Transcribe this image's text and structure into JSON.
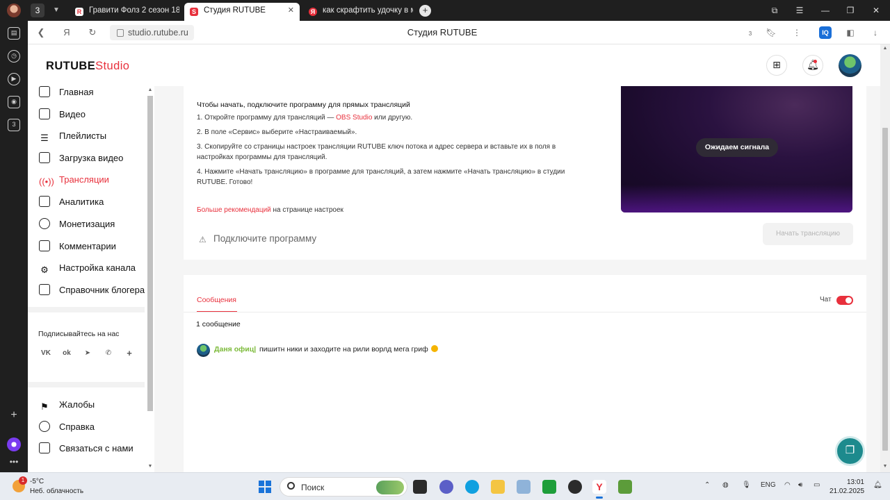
{
  "browser": {
    "window_counter": "3",
    "tabs": [
      {
        "title": "Гравити Фолз 2 сезон 18",
        "active": false
      },
      {
        "title": "Студия RUTUBE",
        "active": true
      },
      {
        "title": "как скрафтить удочку в м",
        "active": false
      }
    ],
    "new_tab": "+",
    "url": "studio.rutube.ru",
    "page_title": "Студия RUTUBE",
    "bookmarks_count": "3"
  },
  "side_panel": {
    "badge": "3"
  },
  "app": {
    "logo_main": "RUTUBE",
    "logo_studio": "Studio"
  },
  "nav": {
    "items": [
      {
        "label": "Главная",
        "icon": "home-icon"
      },
      {
        "label": "Видео",
        "icon": "video-icon"
      },
      {
        "label": "Плейлисты",
        "icon": "playlist-icon"
      },
      {
        "label": "Загрузка видео",
        "icon": "upload-icon"
      },
      {
        "label": "Трансляции",
        "icon": "broadcast-icon",
        "active": true
      },
      {
        "label": "Аналитика",
        "icon": "analytics-icon"
      },
      {
        "label": "Монетизация",
        "icon": "ruble-icon"
      },
      {
        "label": "Комментарии",
        "icon": "comments-icon"
      },
      {
        "label": "Настройка канала",
        "icon": "gear-icon"
      },
      {
        "label": "Справочник блогера",
        "icon": "info-icon"
      }
    ],
    "social_title": "Подписывайтесь на нас",
    "bottom_items": [
      {
        "label": "Жалобы",
        "icon": "flag-icon"
      },
      {
        "label": "Справка",
        "icon": "help-icon"
      },
      {
        "label": "Связаться с нами",
        "icon": "mail-icon"
      }
    ]
  },
  "stream": {
    "instructions_title": "Чтобы начать, подключите программу для прямых трансляций",
    "step1_pre": "1. Откройте программу для трансляций — ",
    "step1_link": "OBS Studio",
    "step1_post": " или другую.",
    "step2": "2. В поле «Сервис» выберите «Настраиваемый».",
    "step3": "3. Скопируйте со страницы настроек трансляции RUTUBE ключ потока и адрес сервера и вставьте их в поля в настройках программы для трансляций.",
    "step4": "4. Нажмите «Начать трансляцию» в программе для трансляций, а затем нажмите «Начать трансляцию» в студии RUTUBE. Готово!",
    "more_link": "Больше рекомендаций",
    "more_text": " на странице настроек",
    "connect_status": "Подключите программу",
    "waiting_signal": "Ожидаем сигнала",
    "start_button": "Начать трансляцию"
  },
  "chat": {
    "tab_messages": "Сообщения",
    "chat_label": "Чат",
    "chat_enabled": true,
    "message_count": "1 сообщение",
    "messages": [
      {
        "author": "Даня офиц|",
        "text": "пишитн ники и заходите на рили ворлд мега гриф"
      }
    ]
  },
  "taskbar": {
    "weather_badge": "1",
    "temperature": "-5°C",
    "weather": "Неб. облачность",
    "search_label": "Поиск",
    "language": "ENG",
    "time": "13:01",
    "date": "21.02.2025"
  },
  "colors": {
    "accent": "#e8303c",
    "author": "#7cba3a",
    "help_fab": "#1d8a8d"
  }
}
